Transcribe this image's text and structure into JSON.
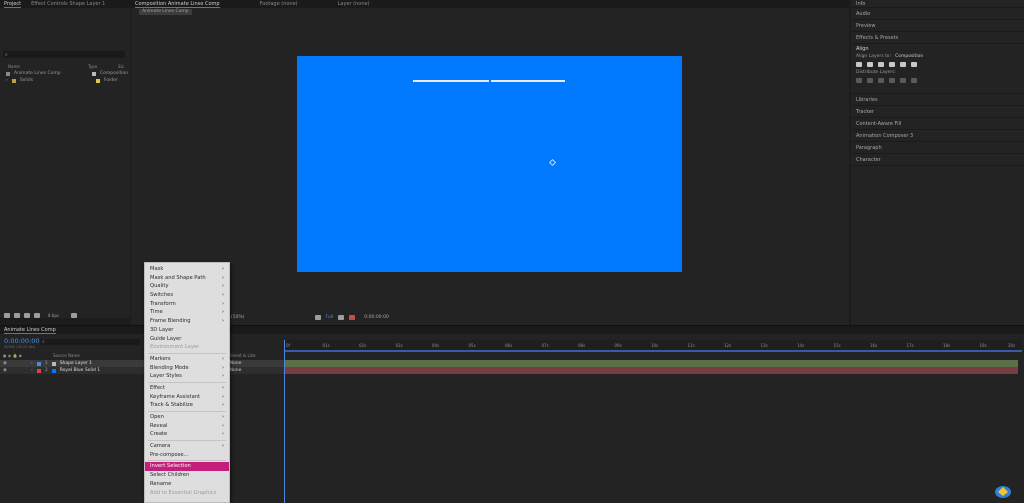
{
  "project_panel": {
    "tabs": [
      "Project",
      "Effect Controls Shape Layer 1"
    ],
    "headers": {
      "name": "Name",
      "type": "Type",
      "size": "Siz"
    },
    "items": [
      {
        "name": "Animate Lines Comp",
        "type": "Composition",
        "color": "#b9b9b9"
      },
      {
        "name": "Solids",
        "type": "Folder",
        "color": "#e3c64a"
      }
    ]
  },
  "viewer": {
    "tabs": [
      "Composition Animate Lines Comp",
      "Footage (none)",
      "Layer (none)"
    ],
    "comp_label": "Animate Lines Comp",
    "comp_color": "#0179fe",
    "zoom": "(50%)",
    "timecode": "0:00:00:00",
    "quality": "Full"
  },
  "right_panel": {
    "items_top": [
      "Info",
      "Audio",
      "Preview",
      "Effects & Presets"
    ],
    "align": {
      "title": "Align",
      "align_to_label": "Align Layers to:",
      "align_to_value": "Composition",
      "distribute_label": "Distribute Layers:"
    },
    "items_bottom": [
      "Libraries",
      "Tracker",
      "Content-Aware Fill",
      "Animation Composer 3",
      "Paragraph",
      "Character"
    ]
  },
  "timeline": {
    "tab": "Animate Lines Comp",
    "timecode": "0:00:00:00",
    "fps": "00000 (30.00 fps)",
    "columns": {
      "source": "Source Name",
      "parent": "Parent & Link"
    },
    "layers": [
      {
        "num": "1",
        "name": "Shape Layer 1",
        "color": "#4b87e0",
        "parent": "None"
      },
      {
        "num": "2",
        "name": "Royal Blue Solid 1",
        "color": "#d4463c",
        "parent": "None"
      }
    ],
    "ruler": [
      "0f",
      "01s",
      "02s",
      "03s",
      "04s",
      "05s",
      "06s",
      "07s",
      "08s",
      "09s",
      "10s",
      "11s",
      "12s",
      "13s",
      "14s",
      "15s",
      "16s",
      "17s",
      "18s",
      "19s",
      "20s"
    ]
  },
  "context_menu": {
    "items": [
      {
        "label": "Mask",
        "sub": true
      },
      {
        "label": "Mask and Shape Path",
        "sub": true
      },
      {
        "label": "Quality",
        "sub": true
      },
      {
        "label": "Switches",
        "sub": true
      },
      {
        "label": "Transform",
        "sub": true
      },
      {
        "label": "Time",
        "sub": true
      },
      {
        "label": "Frame Blending",
        "sub": true
      },
      {
        "label": "3D Layer"
      },
      {
        "label": "Guide Layer"
      },
      {
        "label": "Environment Layer",
        "disabled": true
      },
      {
        "sep": true
      },
      {
        "label": "Markers",
        "sub": true
      },
      {
        "label": "Blending Mode",
        "sub": true
      },
      {
        "label": "Layer Styles",
        "sub": true
      },
      {
        "sep": true
      },
      {
        "label": "Effect",
        "sub": true
      },
      {
        "label": "Keyframe Assistant",
        "sub": true
      },
      {
        "label": "Track & Stabilize",
        "sub": true
      },
      {
        "sep": true
      },
      {
        "label": "Open",
        "sub": true
      },
      {
        "label": "Reveal",
        "sub": true
      },
      {
        "label": "Create",
        "sub": true
      },
      {
        "sep": true
      },
      {
        "label": "Camera",
        "sub": true
      },
      {
        "label": "Pre-compose..."
      },
      {
        "sep": true
      },
      {
        "label": "Invert Selection",
        "highlight": true
      },
      {
        "label": "Select Children"
      },
      {
        "label": "Rename"
      },
      {
        "label": "Add to Essential Graphics",
        "disabled": true
      }
    ]
  }
}
